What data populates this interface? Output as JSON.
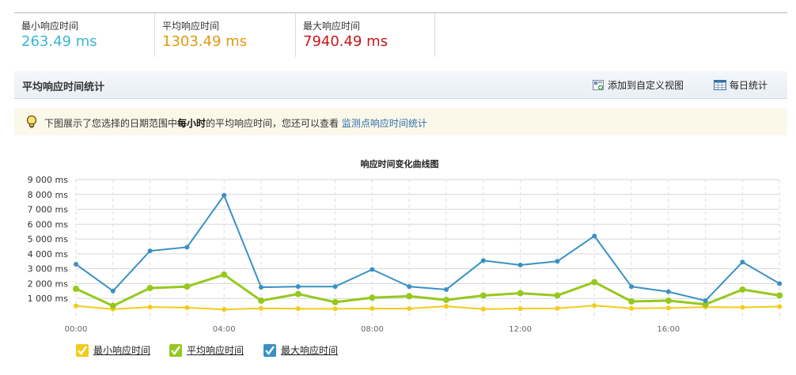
{
  "stats": [
    {
      "label": "最小响应时间",
      "value": "263.49 ms",
      "color": "#3ab5d6"
    },
    {
      "label": "平均响应时间",
      "value": "1303.49 ms",
      "color": "#e09a12"
    },
    {
      "label": "最大响应时间",
      "value": "7940.49 ms",
      "color": "#c8161d"
    }
  ],
  "section": {
    "title": "平均响应时间统计",
    "add_custom_view": "添加到自定义视图",
    "daily_stats": "每日统计"
  },
  "tip": {
    "prefix": "下图展示了您选择的日期范围中",
    "bold": "每小时",
    "suffix": "的平均响应时间，您还可以查看",
    "link": "监测点响应时间统计"
  },
  "chart_data": {
    "type": "line",
    "title": "响应时间变化曲线图",
    "y_unit": "ms",
    "ylim": [
      0,
      9000
    ],
    "y_ticks": [
      "1 000 ms",
      "2 000 ms",
      "3 000 ms",
      "4 000 ms",
      "5 000 ms",
      "6 000 ms",
      "7 000 ms",
      "8 000 ms",
      "9 000 ms"
    ],
    "x_tick_labels": [
      "00:00",
      "04:00",
      "08:00",
      "12:00",
      "16:00"
    ],
    "x": [
      0,
      1,
      2,
      3,
      4,
      5,
      6,
      7,
      8,
      9,
      10,
      11,
      12,
      13,
      14,
      15,
      16,
      17,
      18,
      19
    ],
    "series": [
      {
        "name": "最小响应时间",
        "color": "#f2cc1b",
        "values": [
          500,
          280,
          420,
          380,
          260,
          330,
          310,
          300,
          320,
          320,
          470,
          280,
          320,
          330,
          520,
          330,
          350,
          420,
          400,
          450
        ]
      },
      {
        "name": "平均响应时间",
        "color": "#96c81e",
        "values": [
          1650,
          500,
          1700,
          1800,
          2600,
          850,
          1300,
          750,
          1050,
          1150,
          900,
          1200,
          1350,
          1200,
          2100,
          800,
          850,
          600,
          1600,
          1200
        ]
      },
      {
        "name": "最大响应时间",
        "color": "#3991c3",
        "values": [
          3300,
          1500,
          4200,
          4450,
          7940,
          1750,
          1800,
          1800,
          2950,
          1800,
          1600,
          3550,
          3250,
          3500,
          5200,
          1800,
          1450,
          850,
          3450,
          2000
        ]
      }
    ],
    "grid": true,
    "legend_position": "bottom-left"
  }
}
